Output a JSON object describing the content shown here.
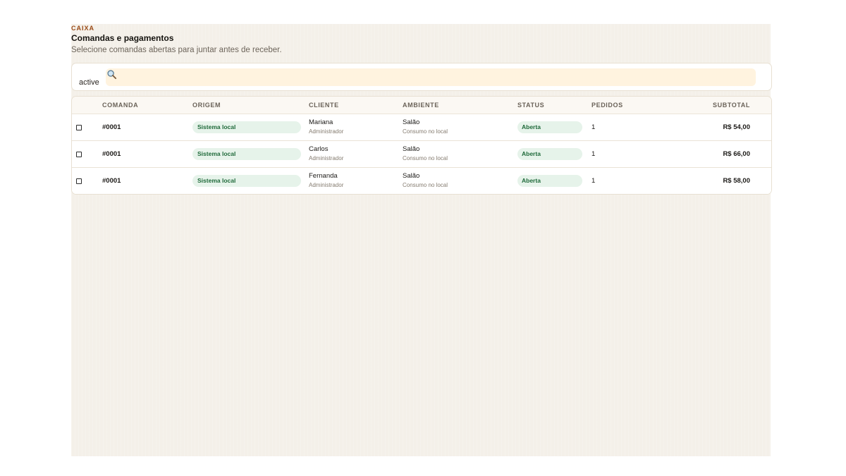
{
  "header": {
    "eyebrow": "CAIXA",
    "title": "Comandas e pagamentos",
    "subtitle": "Selecione comandas abertas para juntar antes de receber."
  },
  "filter": {
    "label": "active",
    "search_icon": "search-icon",
    "search_value": "",
    "search_placeholder": ""
  },
  "table": {
    "columns": [
      "COMANDA",
      "ORIGEM",
      "CLIENTE",
      "AMBIENTE",
      "STATUS",
      "PEDIDOS",
      "SUBTOTAL"
    ],
    "rows": [
      {
        "comanda": "#0001",
        "origem": "Sistema local",
        "cliente": "Mariana",
        "cliente_role": "Administrador",
        "ambiente": "Salão",
        "ambiente_desc": "Consumo no local",
        "status": "Aberta",
        "pedidos": "1",
        "subtotal": "R$ 54,00"
      },
      {
        "comanda": "#0001",
        "origem": "Sistema local",
        "cliente": "Carlos",
        "cliente_role": "Administrador",
        "ambiente": "Salão",
        "ambiente_desc": "Consumo no local",
        "status": "Aberta",
        "pedidos": "1",
        "subtotal": "R$ 66,00"
      },
      {
        "comanda": "#0001",
        "origem": "Sistema local",
        "cliente": "Fernanda",
        "cliente_role": "Administrador",
        "ambiente": "Salão",
        "ambiente_desc": "Consumo no local",
        "status": "Aberta",
        "pedidos": "1",
        "subtotal": "R$ 58,00"
      }
    ]
  },
  "colors": {
    "eyebrow": "#9a4a16",
    "panel_bg": "#f4f0e9",
    "search_bg": "#fff3df",
    "badge_bg": "#e6f3ea",
    "badge_text": "#1f6a3a"
  }
}
